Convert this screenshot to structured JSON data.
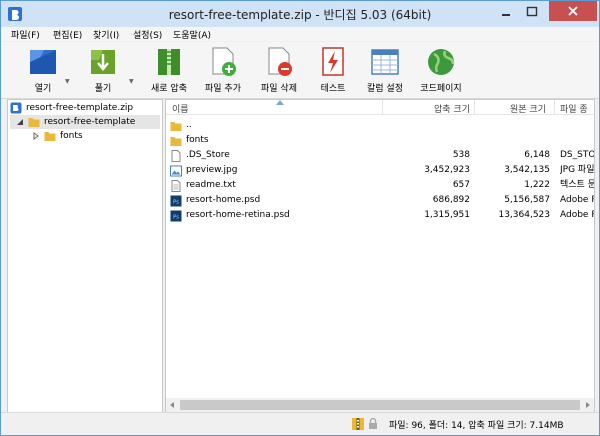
{
  "window": {
    "title": "resort-free-template.zip - 반디집 5.03 (64bit)"
  },
  "menu": [
    "파일(F)",
    "편집(E)",
    "찾기(I)",
    "설정(S)",
    "도움말(A)"
  ],
  "toolbar": {
    "open": "열기",
    "extract": "풀기",
    "new_archive": "새로 압축",
    "add_file": "파일 추가",
    "delete_file": "파일 삭제",
    "test": "테스트",
    "column_settings": "칼럼 설정",
    "codepage": "코드페이지"
  },
  "tree": {
    "root": "resort-free-template.zip",
    "folder": "resort-free-template",
    "subfolder": "fonts"
  },
  "list": {
    "columns": [
      "이름",
      "압축 크기",
      "원본 크기",
      "파일 종"
    ],
    "rows": [
      {
        "name": "..",
        "packed": "",
        "original": "",
        "type": "",
        "icon": "folder-up-icon"
      },
      {
        "name": "fonts",
        "packed": "",
        "original": "",
        "type": "",
        "icon": "folder-icon"
      },
      {
        "name": ".DS_Store",
        "packed": "538",
        "original": "6,148",
        "type": "DS_STO",
        "icon": "file-icon"
      },
      {
        "name": "preview.jpg",
        "packed": "3,452,923",
        "original": "3,542,135",
        "type": "JPG 파일",
        "icon": "image-file-icon"
      },
      {
        "name": "readme.txt",
        "packed": "657",
        "original": "1,222",
        "type": "텍스트 문",
        "icon": "text-file-icon"
      },
      {
        "name": "resort-home.psd",
        "packed": "686,892",
        "original": "5,156,587",
        "type": "Adobe P",
        "icon": "psd-file-icon"
      },
      {
        "name": "resort-home-retina.psd",
        "packed": "1,315,951",
        "original": "13,364,523",
        "type": "Adobe P",
        "icon": "psd-file-icon"
      }
    ]
  },
  "status": {
    "text": "파일: 96, 폴더: 14, 압축 파일 크기: 7.14MB"
  },
  "colors": {
    "accent": "#2e6fd1",
    "title_bar": "#cfe2f6",
    "close": "#c75050",
    "folder": "#e8b93a"
  }
}
